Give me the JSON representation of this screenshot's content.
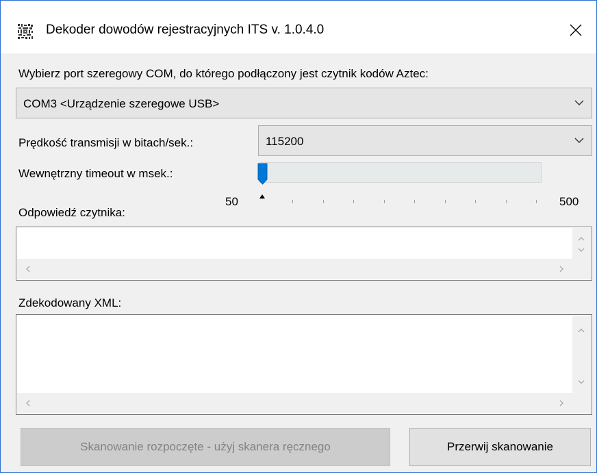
{
  "window": {
    "title": "Dekoder dowodów rejestracyjnych ITS v. 1.0.4.0",
    "accent": "#2b6fd1"
  },
  "icons": {
    "app": "qr-code-icon",
    "close": "close-icon",
    "dropdown": "chevron-down-icon"
  },
  "port": {
    "label": "Wybierz port szeregowy COM, do którego podłączony jest czytnik kodów Aztec:",
    "selected": "COM3 <Urządzenie szeregowe USB>"
  },
  "baud": {
    "label": "Prędkość transmisji w bitach/sek.:",
    "selected": "115200"
  },
  "timeout": {
    "label": "Wewnętrzny timeout w msek.:",
    "min_label": "50",
    "max_label": "500",
    "min": 50,
    "max": 500,
    "value": 50,
    "thumb_color": "#0078d7"
  },
  "reader_response": {
    "label": "Odpowiedź czytnika:",
    "value": ""
  },
  "decoded_xml": {
    "label": "Zdekodowany XML:",
    "value": ""
  },
  "buttons": {
    "scan_status": "Skanowanie rozpoczęte - użyj skanera ręcznego",
    "abort": "Przerwij skanowanie"
  }
}
